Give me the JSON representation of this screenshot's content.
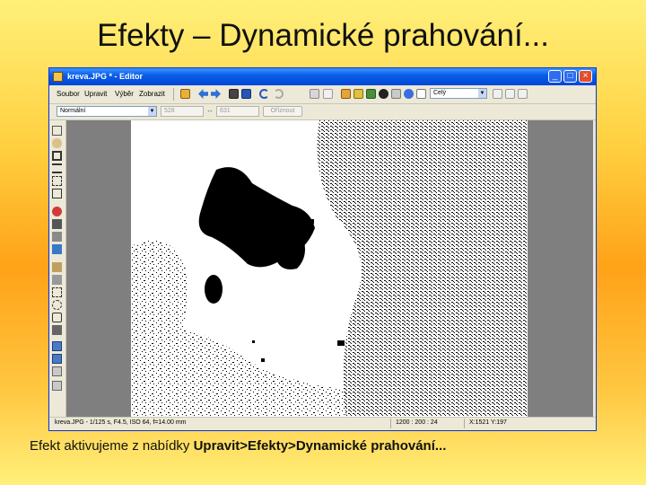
{
  "slide": {
    "title": "Efekty – Dynamické prahování...",
    "caption_prefix": "Efekt aktivujeme z nabídky ",
    "caption_path": "Upravit>Efekty>Dynamické prahování..."
  },
  "window": {
    "title": "kreva.JPG * - Editor",
    "menu": [
      "Soubor",
      "Upravit",
      "Výběr",
      "Zobrazit"
    ],
    "toolbar_combo": "Celý",
    "mode_combo": "Normální",
    "width_field": "528",
    "height_field": "631",
    "optimize_button": "Oříznout",
    "status": {
      "file_info": "kreva.JPG - 1/125 s, F4.5, ISO 64, f=14.00 mm",
      "zoom": "1200 : 200 : 24",
      "coords": "X:1521  Y:197"
    }
  },
  "colors": {
    "titlebar": "#0a5ee8",
    "workspace": "#7f7f7f",
    "window_face": "#ece9d8"
  }
}
